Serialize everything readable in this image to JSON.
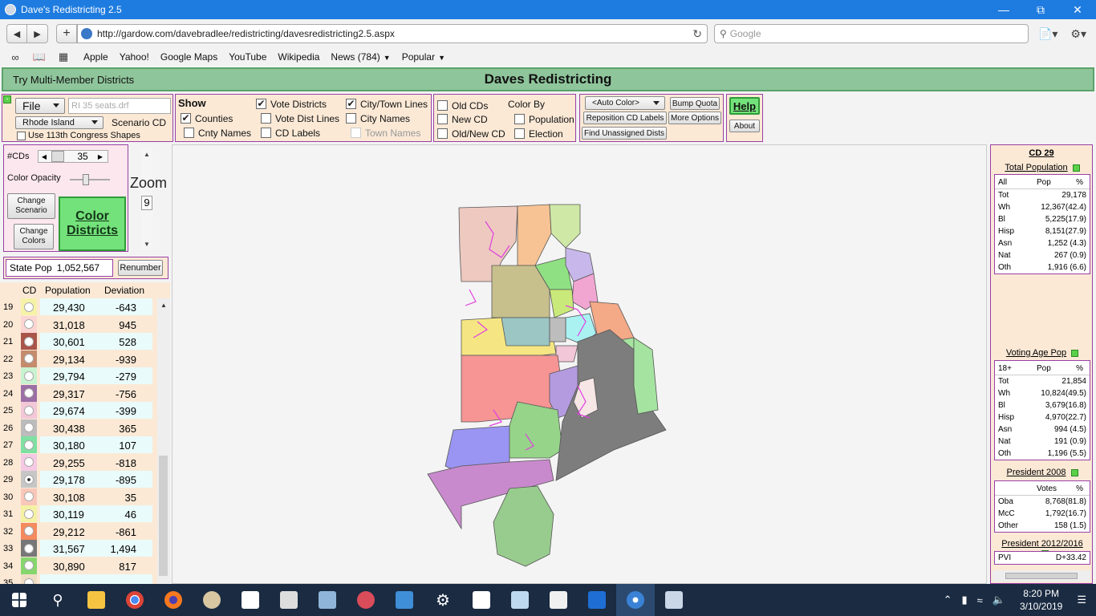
{
  "window": {
    "title": "Dave's Redistricting 2.5",
    "minimize_icon": "—",
    "restore_icon": "⧉",
    "close_icon": "✕"
  },
  "nav": {
    "url": "http://gardow.com/davebradlee/redistricting/davesredistricting2.5.aspx",
    "search_placeholder": "Google"
  },
  "bookmarks": [
    "Apple",
    "Yahoo!",
    "Google Maps",
    "YouTube",
    "Wikipedia",
    "News (784)",
    "Popular"
  ],
  "header": {
    "multi_member": "Try Multi-Member Districts",
    "title": "Daves Redistricting"
  },
  "file_panel": {
    "file_label": "File",
    "file_input": "RI 35 seats.drf",
    "state": "Rhode Island",
    "scenario": "Scenario CD",
    "use113": "Use 113th Congress Shapes"
  },
  "show_panel": {
    "title": "Show",
    "items": [
      {
        "label": "Counties",
        "checked": true
      },
      {
        "label": "Cnty Names",
        "checked": false
      },
      {
        "label": "Vote Districts",
        "checked": true
      },
      {
        "label": "Vote Dist Lines",
        "checked": false
      },
      {
        "label": "CD Labels",
        "checked": false
      },
      {
        "label": "City/Town Lines",
        "checked": true
      },
      {
        "label": "City Names",
        "checked": false
      },
      {
        "label": "Town Names",
        "checked": false
      }
    ]
  },
  "color_panel": {
    "title": "Color By",
    "items": [
      {
        "label": "Old CDs",
        "checked": false
      },
      {
        "label": "New CD",
        "checked": false
      },
      {
        "label": "Old/New CD",
        "checked": false
      },
      {
        "label": "Population",
        "checked": false
      },
      {
        "label": "Election",
        "checked": false
      }
    ]
  },
  "buttons": {
    "auto_color": "<Auto Color>",
    "bump_quota": "Bump Quota",
    "reposition": "Reposition CD Labels",
    "more_options": "More Options",
    "find_unassigned": "Find Unassigned Dists",
    "help": "Help",
    "about": "About"
  },
  "left": {
    "cds_label": "#CDs",
    "cds_value": "35",
    "opacity_label": "Color Opacity",
    "change_scenario": "Change Scenario",
    "change_colors": "Change Colors",
    "color_districts": "Color Districts",
    "zoom_label": "Zoom",
    "zoom_value": "9",
    "state_pop_label": "State Pop",
    "state_pop_value": "1,052,567",
    "renumber": "Renumber"
  },
  "table": {
    "headers": [
      "CD",
      "Population",
      "Deviation"
    ],
    "rows": [
      {
        "cd": "19",
        "pop": "29,430",
        "dev": "-643",
        "color": "#f6f3a9"
      },
      {
        "cd": "20",
        "pop": "31,018",
        "dev": "945",
        "color": "#fbd5d2"
      },
      {
        "cd": "21",
        "pop": "30,601",
        "dev": "528",
        "color": "#a9554a"
      },
      {
        "cd": "22",
        "pop": "29,134",
        "dev": "-939",
        "color": "#c48b6c"
      },
      {
        "cd": "23",
        "pop": "29,794",
        "dev": "-279",
        "color": "#c8f2d0"
      },
      {
        "cd": "24",
        "pop": "29,317",
        "dev": "-756",
        "color": "#9b6fa5"
      },
      {
        "cd": "25",
        "pop": "29,674",
        "dev": "-399",
        "color": "#f2c7d7"
      },
      {
        "cd": "26",
        "pop": "30,438",
        "dev": "365",
        "color": "#bcbcbc"
      },
      {
        "cd": "27",
        "pop": "30,180",
        "dev": "107",
        "color": "#7ee0a2"
      },
      {
        "cd": "28",
        "pop": "29,255",
        "dev": "-818",
        "color": "#f5c9e4"
      },
      {
        "cd": "29",
        "pop": "29,178",
        "dev": "-895",
        "color": "#c6c6c6"
      },
      {
        "cd": "30",
        "pop": "30,108",
        "dev": "35",
        "color": "#f9c7b9"
      },
      {
        "cd": "31",
        "pop": "30,119",
        "dev": "46",
        "color": "#f4f1a4"
      },
      {
        "cd": "32",
        "pop": "29,212",
        "dev": "-861",
        "color": "#f58a5f"
      },
      {
        "cd": "33",
        "pop": "31,567",
        "dev": "1,494",
        "color": "#777777"
      },
      {
        "cd": "34",
        "pop": "30,890",
        "dev": "817",
        "color": "#86d66e"
      },
      {
        "cd": "35",
        "pop": "",
        "dev": "",
        "color": "#f0ddc6"
      }
    ]
  },
  "right": {
    "cd_title": "CD 29",
    "total_pop": {
      "title": "Total Population",
      "header": [
        "All",
        "Pop",
        "%"
      ],
      "rows": [
        [
          "Tot",
          "29,178",
          ""
        ],
        [
          "Wh",
          "12,367(42.4)",
          ""
        ],
        [
          "Bl",
          "5,225(17.9)",
          ""
        ],
        [
          "Hisp",
          "8,151(27.9)",
          ""
        ],
        [
          "Asn",
          "1,252 (4.3)",
          ""
        ],
        [
          "Nat",
          "267 (0.9)",
          ""
        ],
        [
          "Oth",
          "1,916 (6.6)",
          ""
        ]
      ]
    },
    "vap": {
      "title": "Voting Age Pop",
      "header": [
        "18+",
        "Pop",
        "%"
      ],
      "rows": [
        [
          "Tot",
          "21,854",
          ""
        ],
        [
          "Wh",
          "10,824(49.5)",
          ""
        ],
        [
          "Bl",
          "3,679(16.8)",
          ""
        ],
        [
          "Hisp",
          "4,970(22.7)",
          ""
        ],
        [
          "Asn",
          "994 (4.5)",
          ""
        ],
        [
          "Nat",
          "191 (0.9)",
          ""
        ],
        [
          "Oth",
          "1,196 (5.5)",
          ""
        ]
      ]
    },
    "pres2008": {
      "title": "President 2008",
      "header": [
        "",
        "Votes",
        "%"
      ],
      "rows": [
        [
          "Oba",
          "8,768(81.8)",
          ""
        ],
        [
          "McC",
          "1,792(16.7)",
          ""
        ],
        [
          "Other",
          "158 (1.5)",
          ""
        ]
      ]
    },
    "pres2012": {
      "title": "President 2012/2016",
      "rows": [
        [
          "PVI",
          "D+33.42",
          ""
        ]
      ]
    }
  },
  "tray": {
    "time": "8:20 PM",
    "date": "3/10/2019"
  }
}
